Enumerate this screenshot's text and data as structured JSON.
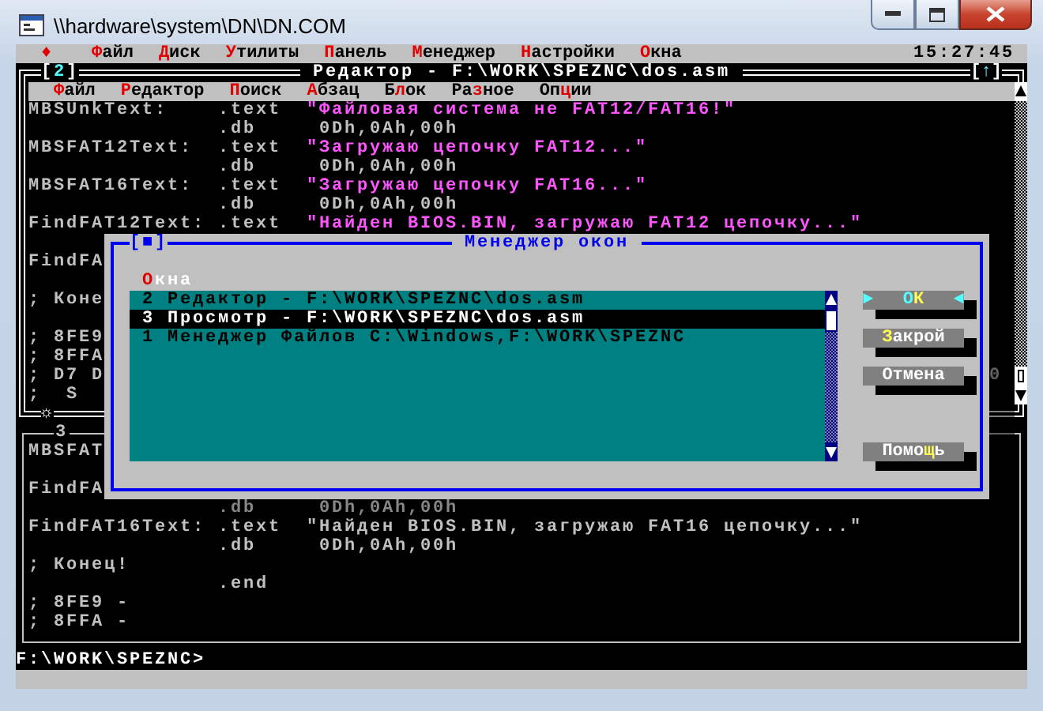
{
  "window": {
    "title": "\\\\hardware\\system\\DN\\DN.COM"
  },
  "menu_bar": {
    "system_glyph": "♦",
    "items": [
      {
        "hot": "Ф",
        "post": "айл"
      },
      {
        "hot": "Д",
        "post": "иск"
      },
      {
        "hot": "У",
        "post": "тилиты"
      },
      {
        "hot": "П",
        "post": "анель"
      },
      {
        "hot": "М",
        "post": "енеджер"
      },
      {
        "hot": "Н",
        "post": "астройки"
      },
      {
        "hot": "О",
        "post": "кна"
      }
    ],
    "clock": "15:27:45"
  },
  "editors": [
    {
      "active": true,
      "tag": {
        "open": "[",
        "text": "2",
        "close": "]"
      },
      "title": "Редактор - F:\\WORK\\SPEZNC\\dos.asm",
      "zoom": {
        "open": "[",
        "text": "↑",
        "close": "]"
      },
      "bottom_glyph": "☼",
      "menu": [
        {
          "hot": "Ф",
          "post": "айл"
        },
        {
          "hot": "Р",
          "post": "едактор"
        },
        {
          "hot": "П",
          "post": "оиск"
        },
        {
          "hot": "А",
          "post": "бзац"
        },
        {
          "pre": "Б",
          "hot": "л",
          "post": "ок"
        },
        {
          "pre": "Ра",
          "hot": "з",
          "post": "ное"
        },
        {
          "pre": "Оп",
          "hot": "ц",
          "post": "ии"
        }
      ],
      "lines": [
        {
          "kind": "string",
          "label": "MBSUnkText:",
          "directive": ".text",
          "operand": "\"Файловая система не FAT12/FAT16!\""
        },
        {
          "kind": "data",
          "directive": ".db",
          "operand": "0Dh,0Ah,00h"
        },
        {
          "kind": "string",
          "label": "MBSFAT12Text:",
          "directive": ".text",
          "operand": "\"Загружаю цепочку FAT12...\""
        },
        {
          "kind": "data",
          "directive": ".db",
          "operand": "0Dh,0Ah,00h"
        },
        {
          "kind": "string",
          "label": "MBSFAT16Text:",
          "directive": ".text",
          "operand": "\"Загружаю цепочку FAT16...\""
        },
        {
          "kind": "data",
          "directive": ".db",
          "operand": "0Dh,0Ah,00h"
        },
        {
          "kind": "string",
          "label": "FindFAT12Text:",
          "directive": ".text",
          "operand": "\"Найден BIOS.BIN, загружаю FAT12 цепочку...\""
        },
        {
          "kind": "blank"
        },
        {
          "kind": "plain",
          "label": "FindFA"
        },
        {
          "kind": "blank"
        },
        {
          "kind": "plain",
          "label": "; Коне"
        },
        {
          "kind": "blank"
        },
        {
          "kind": "plain",
          "label": "; 8FE9"
        },
        {
          "kind": "plain",
          "label": "; 8FFA"
        },
        {
          "kind": "plain",
          "label": "; D7 D",
          "tail": "0"
        },
        {
          "kind": "plain",
          "label": ";  S"
        }
      ]
    },
    {
      "active": false,
      "tag": {
        "text": "3"
      },
      "lines": [
        {
          "kind": "plain",
          "label": "MBSFAT"
        },
        {
          "kind": "blank"
        },
        {
          "kind": "plain",
          "label": "FindFA"
        },
        {
          "kind": "data",
          "directive": ".db",
          "operand": "0Dh,0Ah,00h"
        },
        {
          "kind": "string",
          "label": "FindFAT16Text:",
          "directive": ".text",
          "operand": "\"Найден BIOS.BIN, загружаю FAT16 цепочку...\""
        },
        {
          "kind": "data",
          "directive": ".db",
          "operand": "0Dh,0Ah,00h"
        },
        {
          "kind": "plain",
          "label": "; Конец!"
        },
        {
          "kind": "plain",
          "directive": ".end"
        },
        {
          "kind": "plain",
          "label": "; 8FE9 -"
        },
        {
          "kind": "plain",
          "label": "; 8FFA -"
        }
      ]
    }
  ],
  "prompt": "F:\\WORK\\SPEZNC>",
  "dialog": {
    "tag": {
      "open": "[",
      "text": "■",
      "close": "]"
    },
    "title": "Менеджер окон",
    "label": {
      "hot": "О",
      "post": "кна"
    },
    "items": [
      {
        "text": "2 Редактор - F:\\WORK\\SPEZNC\\dos.asm",
        "selected": false
      },
      {
        "text": "3 Просмотр - F:\\WORK\\SPEZNC\\dos.asm",
        "selected": true
      },
      {
        "text": "1 Менеджер Файлов C:\\Windows,F:\\WORK\\SPEZNC",
        "selected": false
      }
    ],
    "buttons": [
      {
        "pre": "О",
        "hot": "К",
        "default": true,
        "marks": {
          "left": "►",
          "right": "◄"
        }
      },
      {
        "hot": "З",
        "post": "акрой",
        "default": false
      },
      {
        "pre": "Отмена",
        "default": false
      },
      {
        "pre": "Помо",
        "hot": "щ",
        "post": "ь",
        "default": false
      }
    ]
  }
}
